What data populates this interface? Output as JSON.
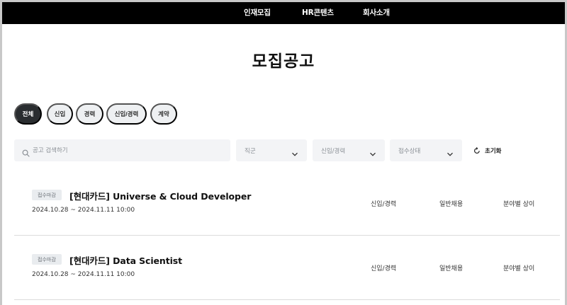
{
  "nav": {
    "items": [
      {
        "label": "인재모집"
      },
      {
        "label": "HR콘텐츠"
      },
      {
        "label": "회사소개"
      }
    ]
  },
  "page": {
    "title": "모집공고"
  },
  "tabs": [
    {
      "label": "전체",
      "active": true
    },
    {
      "label": "신입",
      "active": false
    },
    {
      "label": "경력",
      "active": false
    },
    {
      "label": "신입/경력",
      "active": false
    },
    {
      "label": "계약",
      "active": false
    }
  ],
  "filters": {
    "search_placeholder": "공고 검색하기",
    "job_type": "직군",
    "career": "신입/경력",
    "status": "접수상태",
    "reset_label": "초기화"
  },
  "jobs": [
    {
      "badge": "접수마감",
      "title": "[현대카드] Universe & Cloud Developer",
      "period": "2024.10.28 ~ 2024.11.11 10:00",
      "career": "신입/경력",
      "employment": "일반채용",
      "field": "분야별 상이"
    },
    {
      "badge": "접수마감",
      "title": "[현대카드] Data Scientist",
      "period": "2024.10.28 ~ 2024.11.11 10:00",
      "career": "신입/경력",
      "employment": "일반채용",
      "field": "분야별 상이"
    }
  ],
  "colors": {
    "nav_background": "#000000",
    "active_tab": "#2a2d30",
    "chip_background": "#eef0f2",
    "input_background": "#f3f4f6"
  }
}
